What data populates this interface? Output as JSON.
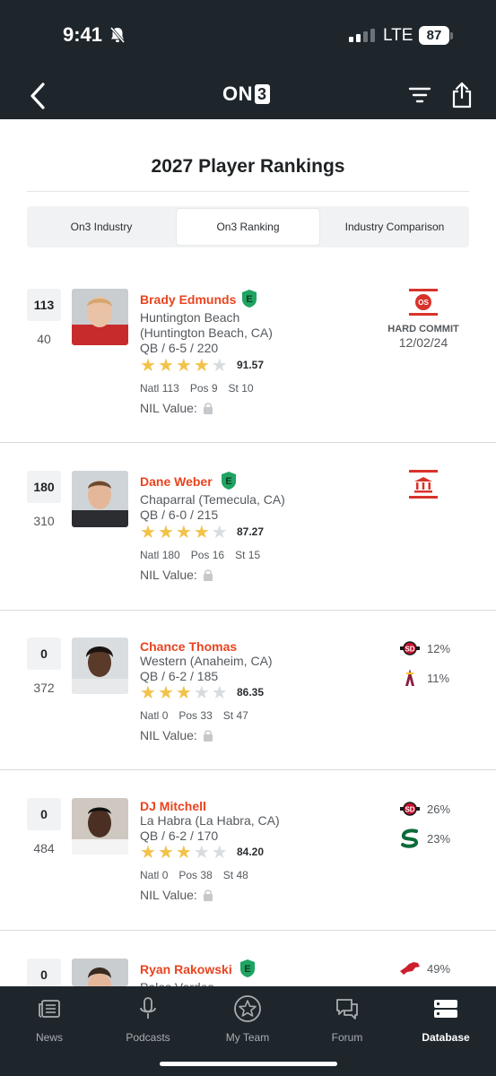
{
  "status": {
    "time": "9:41",
    "network": "LTE",
    "battery": "87"
  },
  "header": {
    "logo_text": "ON",
    "logo_box": "3",
    "back_icon": "chevron-left-icon",
    "filter_icon": "filter-icon",
    "share_icon": "share-icon"
  },
  "page": {
    "title": "2027 Player Rankings"
  },
  "tabs": [
    {
      "label": "On3 Industry",
      "active": false
    },
    {
      "label": "On3 Ranking",
      "active": true
    },
    {
      "label": "Industry Comparison",
      "active": false
    }
  ],
  "players": [
    {
      "rank": "113",
      "sub_rank": "40",
      "name": "Brady Edmunds",
      "verified": true,
      "location": "Huntington Beach (Huntington Beach, CA)",
      "position_line": "QB / 6-5 / 220",
      "stars": 4,
      "rating": "91.57",
      "natl_label": "Natl",
      "natl": "113",
      "pos_label": "Pos",
      "pos": "9",
      "st_label": "St",
      "st": "10",
      "nil_label": "NIL Value:",
      "commit_status": "HARD COMMIT",
      "commit_date": "12/02/24",
      "school_icon": "ohio-state-logo-icon"
    },
    {
      "rank": "180",
      "sub_rank": "310",
      "name": "Dane Weber",
      "verified": true,
      "location": "Chaparral (Temecula, CA)",
      "position_line": "QB / 6-0 / 215",
      "stars": 4,
      "rating": "87.27",
      "natl_label": "Natl",
      "natl": "180",
      "pos_label": "Pos",
      "pos": "16",
      "st_label": "St",
      "st": "15",
      "nil_label": "NIL Value:",
      "school_icon": "school-building-icon"
    },
    {
      "rank": "0",
      "sub_rank": "372",
      "name": "Chance Thomas",
      "verified": false,
      "location": "Western (Anaheim, CA)",
      "position_line": "QB / 6-2 / 185",
      "stars": 3,
      "rating": "86.35",
      "natl_label": "Natl",
      "natl": "0",
      "pos_label": "Pos",
      "pos": "33",
      "st_label": "St",
      "st": "47",
      "nil_label": "NIL Value:",
      "predictions": [
        {
          "icon": "san-diego-state-logo-icon",
          "pct": "12%"
        },
        {
          "icon": "arizona-state-logo-icon",
          "pct": "11%"
        }
      ]
    },
    {
      "rank": "0",
      "sub_rank": "484",
      "name": "DJ Mitchell",
      "verified": false,
      "location": "La Habra (La Habra, CA)",
      "position_line": "QB / 6-2 / 170",
      "stars": 3,
      "rating": "84.20",
      "natl_label": "Natl",
      "natl": "0",
      "pos_label": "Pos",
      "pos": "38",
      "st_label": "St",
      "st": "48",
      "nil_label": "NIL Value:",
      "predictions": [
        {
          "icon": "san-diego-state-logo-icon",
          "pct": "26%"
        },
        {
          "icon": "sacramento-state-logo-icon",
          "pct": "23%"
        }
      ]
    },
    {
      "rank": "0",
      "name": "Ryan Rakowski",
      "verified": true,
      "location_partial": "Palos Verdes",
      "predictions": [
        {
          "icon": "smu-mustang-logo-icon",
          "pct": "49%"
        }
      ]
    }
  ],
  "bottom_nav": [
    {
      "label": "News",
      "icon": "news-icon",
      "active": false
    },
    {
      "label": "Podcasts",
      "icon": "microphone-icon",
      "active": false
    },
    {
      "label": "My Team",
      "icon": "star-icon",
      "active": false
    },
    {
      "label": "Forum",
      "icon": "forum-icon",
      "active": false
    },
    {
      "label": "Database",
      "icon": "database-icon",
      "active": true
    }
  ],
  "colors": {
    "header_bg": "#1e262c",
    "accent": "#e9441f",
    "star": "#f2c24a",
    "verified": "#1fa463"
  }
}
